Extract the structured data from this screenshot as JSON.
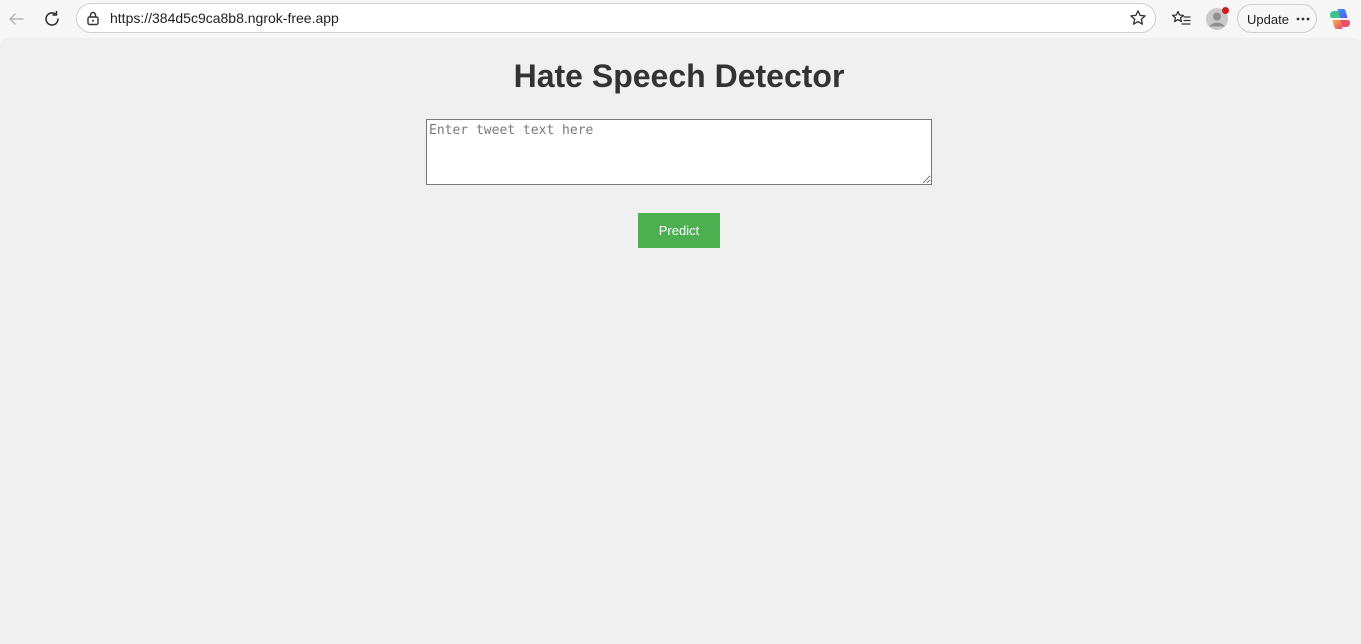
{
  "browser": {
    "url": "https://384d5c9ca8b8.ngrok-free.app",
    "update_label": "Update",
    "icons": {
      "back": "back-arrow-icon",
      "reload": "reload-icon",
      "lock": "lock-icon",
      "favorite": "star-icon",
      "favorites": "favorites-icon",
      "profile": "profile-avatar",
      "more": "more-icon",
      "copilot": "copilot-icon"
    }
  },
  "page": {
    "title": "Hate Speech Detector",
    "tweet_input": {
      "placeholder": "Enter tweet text here",
      "value": ""
    },
    "predict_label": "Predict"
  },
  "colors": {
    "page_background": "#f0f0f0",
    "title_text": "#333333",
    "predict_button": "#4caf50",
    "notification_dot": "#d01a1a"
  }
}
